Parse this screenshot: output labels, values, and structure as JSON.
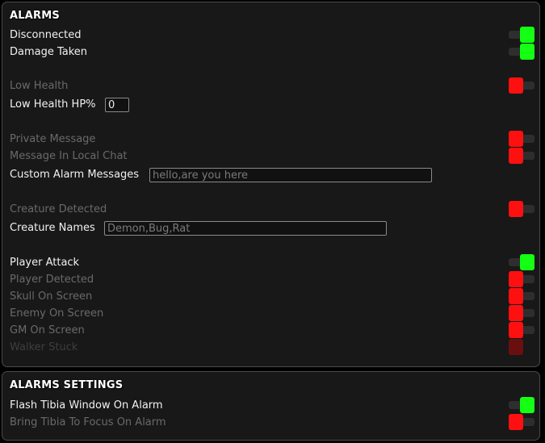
{
  "alarms": {
    "title": "ALARMS",
    "rows": {
      "disconnected": "Disconnected",
      "damage_taken": "Damage Taken",
      "low_health": "Low Health",
      "low_health_hp": "Low Health HP%",
      "private_message": "Private Message",
      "local_chat": "Message In Local Chat",
      "custom_messages": "Custom Alarm Messages",
      "creature_detected": "Creature Detected",
      "creature_names": "Creature Names",
      "player_attack": "Player Attack",
      "player_detected": "Player Detected",
      "skull_on_screen": "Skull On Screen",
      "enemy_on_screen": "Enemy On Screen",
      "gm_on_screen": "GM On Screen",
      "walker_stuck": "Walker Stuck"
    },
    "inputs": {
      "low_health_hp_value": "0",
      "custom_messages_placeholder": "hello,are you here",
      "creature_names_placeholder": "Demon,Bug,Rat"
    },
    "toggles": {
      "disconnected": true,
      "damage_taken": true,
      "low_health": false,
      "private_message": false,
      "local_chat": false,
      "creature_detected": false,
      "player_attack": true,
      "player_detected": false,
      "skull_on_screen": false,
      "enemy_on_screen": false,
      "gm_on_screen": false,
      "walker_stuck": false
    }
  },
  "alarms_settings": {
    "title": "ALARMS SETTINGS",
    "rows": {
      "flash_window": "Flash Tibia Window On Alarm",
      "bring_to_focus": "Bring Tibia To Focus On Alarm"
    },
    "toggles": {
      "flash_window": true,
      "bring_to_focus": false
    }
  },
  "colors": {
    "toggle_on": "#14ff14",
    "toggle_off": "#ff1010",
    "panel_bg": "#181818",
    "panel_border": "#4a4a4a"
  }
}
